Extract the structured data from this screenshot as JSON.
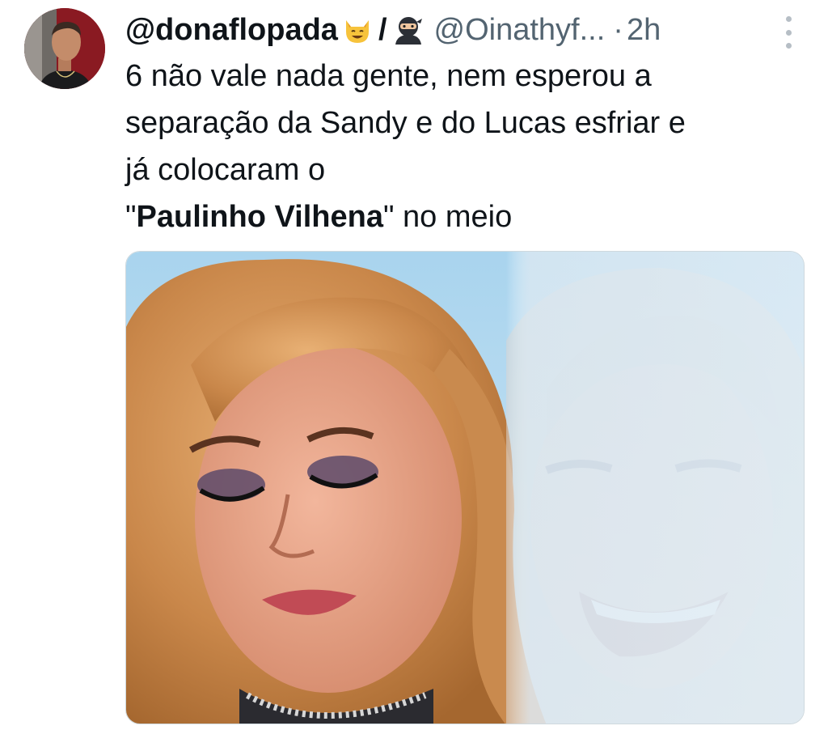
{
  "tweet": {
    "display_name": "@donaflopada",
    "emoji_1": "cat-face-emoji",
    "separator": "/",
    "emoji_2": "ninja-emoji",
    "handle": "@Oinathyf...",
    "dot": "·",
    "time": "2h",
    "text_line_1": "6 não vale nada gente, nem esperou a",
    "text_line_2": "separação da Sandy e do Lucas esfriar e",
    "text_line_3": "já colocaram o",
    "text_line_4_quote_open": "\"",
    "text_line_4_bold": "Paulinho Vilhena",
    "text_line_4_rest": "\" no meio",
    "more_icon": "more-vertical-icon",
    "avatar_icon": "profile-avatar",
    "media_description_icon": "meme-image"
  },
  "colors": {
    "text": "#0f1419",
    "secondary": "#536471",
    "avatar_bg": "#8a1a22",
    "border": "#cfd9de"
  }
}
